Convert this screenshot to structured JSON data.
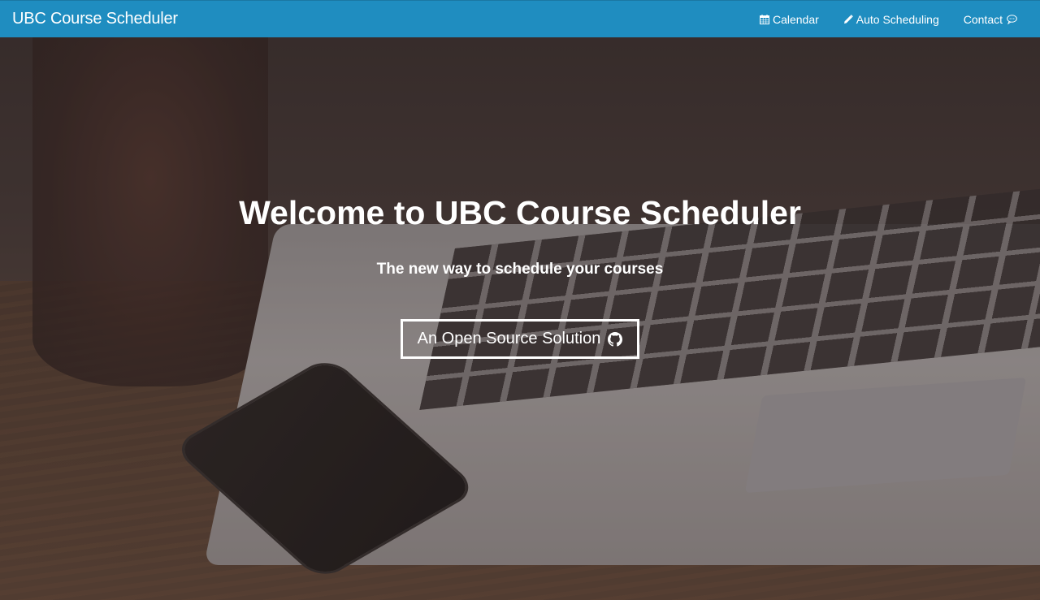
{
  "navbar": {
    "brand": "UBC Course Scheduler",
    "links": [
      {
        "label": "Calendar",
        "icon": "calendar-icon"
      },
      {
        "label": "Auto Scheduling",
        "icon": "pencil-icon"
      },
      {
        "label": "Contact",
        "icon": "chat-bubble-icon"
      }
    ],
    "background_color": "#1f8dc0"
  },
  "hero": {
    "title": "Welcome to UBC Course Scheduler",
    "subtitle": "The new way to schedule your courses",
    "cta_label": "An Open Source Solution",
    "cta_icon": "github-icon"
  }
}
